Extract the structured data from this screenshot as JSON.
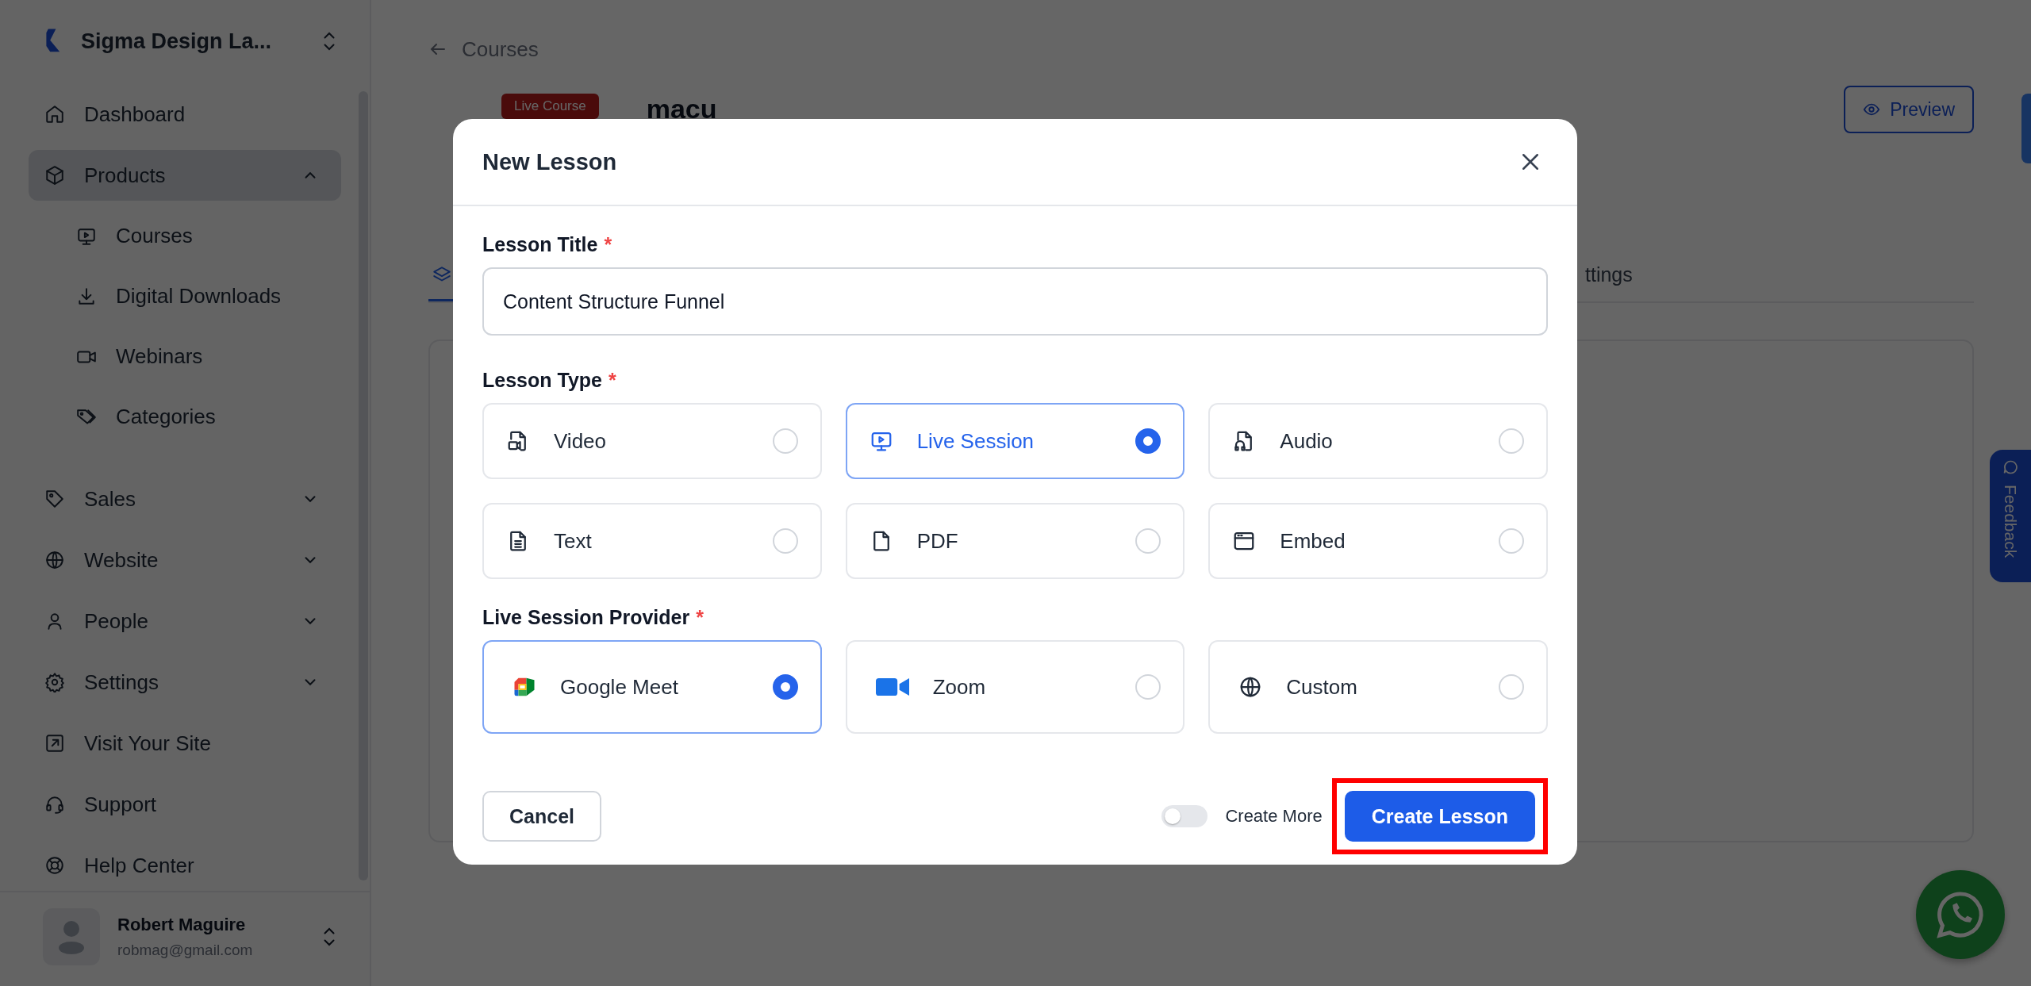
{
  "sidebar": {
    "workspace": "Sigma Design La...",
    "items": [
      {
        "label": "Dashboard",
        "selected": false
      },
      {
        "label": "Products",
        "selected": true,
        "expanded": true,
        "children": [
          {
            "label": "Courses"
          },
          {
            "label": "Digital Downloads"
          },
          {
            "label": "Webinars"
          },
          {
            "label": "Categories"
          }
        ]
      },
      {
        "label": "Sales",
        "selected": false,
        "expanded": false
      },
      {
        "label": "Website",
        "selected": false,
        "expanded": false
      },
      {
        "label": "People",
        "selected": false,
        "expanded": false
      },
      {
        "label": "Settings",
        "selected": false,
        "expanded": false
      },
      {
        "label": "Visit Your Site",
        "selected": false
      },
      {
        "label": "Support",
        "selected": false
      },
      {
        "label": "Help Center",
        "selected": false
      }
    ],
    "user": {
      "name": "Robert Maguire",
      "email": "robmag@gmail.com"
    }
  },
  "page": {
    "back_link": "Courses",
    "badge": "Live Course",
    "title": "macu",
    "preview_button": "Preview",
    "tabs": [
      {
        "selected": true
      },
      {
        "label": "ttings",
        "selected": false
      }
    ]
  },
  "feedback_tab": "Feedback",
  "modal": {
    "title": "New Lesson",
    "title_field": {
      "label": "Lesson Title",
      "required_mark": "*",
      "value": "Content Structure Funnel"
    },
    "lesson_type": {
      "label": "Lesson Type",
      "required_mark": "*",
      "options": [
        {
          "label": "Video",
          "selected": false
        },
        {
          "label": "Live Session",
          "selected": true
        },
        {
          "label": "Audio",
          "selected": false
        },
        {
          "label": "Text",
          "selected": false
        },
        {
          "label": "PDF",
          "selected": false
        },
        {
          "label": "Embed",
          "selected": false
        }
      ]
    },
    "provider": {
      "label": "Live Session Provider",
      "required_mark": "*",
      "options": [
        {
          "label": "Google Meet",
          "selected": true
        },
        {
          "label": "Zoom",
          "selected": false
        },
        {
          "label": "Custom",
          "selected": false
        }
      ]
    },
    "cancel_button": "Cancel",
    "create_more": {
      "label": "Create More",
      "on": false
    },
    "create_button": {
      "label": "Create Lesson",
      "highlighted": true
    }
  }
}
